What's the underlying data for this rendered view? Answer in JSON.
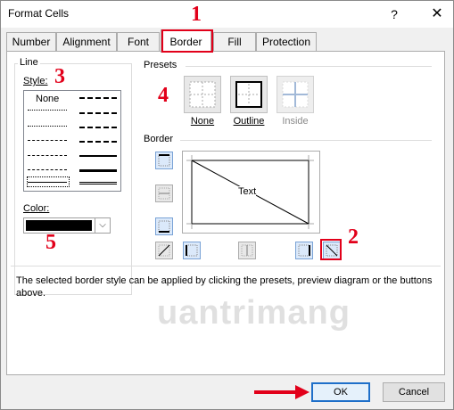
{
  "window": {
    "title": "Format Cells",
    "help": "?",
    "close": "✕"
  },
  "tabs": [
    {
      "label": "Number"
    },
    {
      "label": "Alignment"
    },
    {
      "label": "Font"
    },
    {
      "label": "Border",
      "active": true
    },
    {
      "label": "Fill"
    },
    {
      "label": "Protection"
    }
  ],
  "line": {
    "group_label": "Line",
    "style_label": "Style:",
    "none_label": "None",
    "color_label": "Color:",
    "color_value": "#000000"
  },
  "presets": {
    "group_label": "Presets",
    "items": [
      {
        "label": "None"
      },
      {
        "label": "Outline"
      },
      {
        "label": "Inside",
        "disabled": true
      }
    ]
  },
  "border": {
    "group_label": "Border",
    "preview_text": "Text"
  },
  "note": "The selected border style can be applied by clicking the presets, preview diagram or the buttons above.",
  "watermark": "uantrimang",
  "buttons": {
    "ok": "OK",
    "cancel": "Cancel"
  },
  "annotations": {
    "n1": "1",
    "n2": "2",
    "n3": "3",
    "n4": "4",
    "n5": "5"
  },
  "colors": {
    "annotation": "#e2001a",
    "accent": "#1e6fc9"
  }
}
